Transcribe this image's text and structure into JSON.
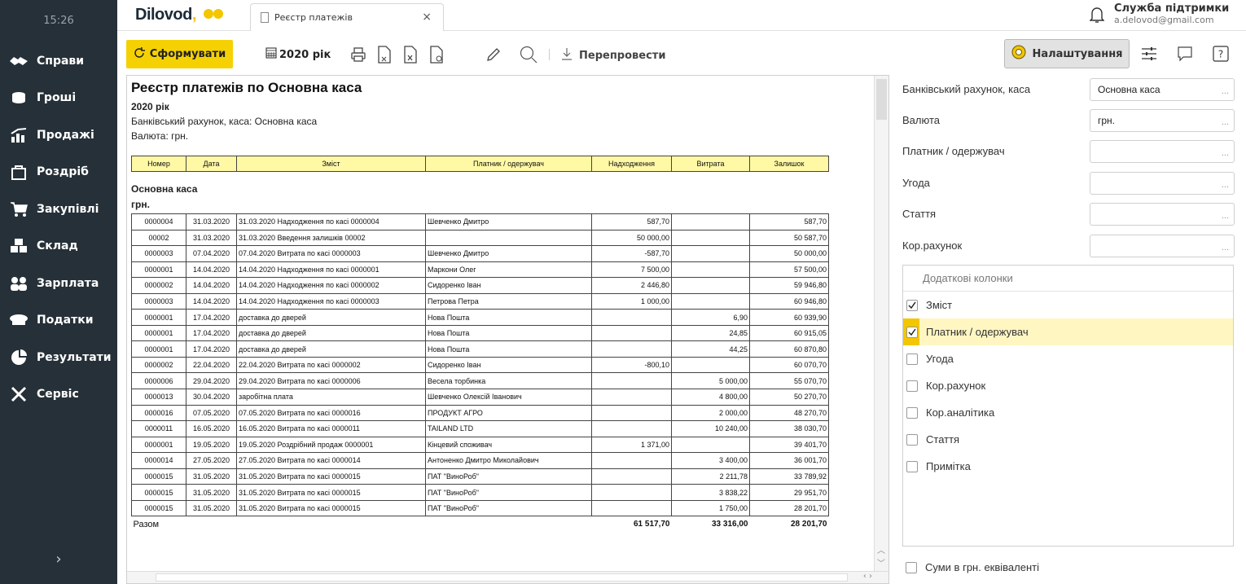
{
  "sidebar": {
    "time": "15:26",
    "items": [
      {
        "label": "Справи",
        "icon": "handshake-icon"
      },
      {
        "label": "Гроші",
        "icon": "coins-icon"
      },
      {
        "label": "Продажі",
        "icon": "chart-icon"
      },
      {
        "label": "Роздріб",
        "icon": "shopping-bag-icon"
      },
      {
        "label": "Закупівлі",
        "icon": "cart-icon"
      },
      {
        "label": "Склад",
        "icon": "boxes-icon"
      },
      {
        "label": "Зарплата",
        "icon": "people-icon"
      },
      {
        "label": "Податки",
        "icon": "hat-icon"
      },
      {
        "label": "Результати",
        "icon": "pie-chart-icon"
      },
      {
        "label": "Сервіс",
        "icon": "tools-icon"
      }
    ],
    "expand": "›"
  },
  "topbar": {
    "logo": "Dilovod",
    "logo_comma": ",",
    "tab_title": "Реєстр платежів",
    "tab_close": "×",
    "support_title": "Служба підтримки",
    "support_email": "a.delovod@gmail.com"
  },
  "toolbar": {
    "form_label": "Сформувати",
    "year_label": "2020 рік",
    "repost_label": "Перепровести",
    "settings_label": "Налаштування"
  },
  "report": {
    "title": "Реєстр платежів по Основна каса",
    "period": "2020 рік",
    "account_line": "Банківський рахунок, каса: Основна каса",
    "currency_line": "Валюта: грн.",
    "headers": [
      "Номер",
      "Дата",
      "Зміст",
      "Платник / одержувач",
      "Надходження",
      "Витрата",
      "Залишок"
    ],
    "group": "Основна каса",
    "group_currency": "грн.",
    "rows": [
      [
        "0000004",
        "31.03.2020",
        "31.03.2020 Надходження по касі 0000004",
        "Шевченко Дмитро",
        "587,70",
        "",
        "587,70"
      ],
      [
        "00002",
        "31.03.2020",
        "31.03.2020 Введення залишків 00002",
        "",
        "50 000,00",
        "",
        "50 587,70"
      ],
      [
        "0000003",
        "07.04.2020",
        "07.04.2020 Витрата по касі 0000003",
        "Шевченко Дмитро",
        "-587,70",
        "",
        "50 000,00"
      ],
      [
        "0000001",
        "14.04.2020",
        "14.04.2020 Надходження по касі 0000001",
        "Маркони Олег",
        "7 500,00",
        "",
        "57 500,00"
      ],
      [
        "0000002",
        "14.04.2020",
        "14.04.2020 Надходження по касі 0000002",
        "Сидоренко Іван",
        "2 446,80",
        "",
        "59 946,80"
      ],
      [
        "0000003",
        "14.04.2020",
        "14.04.2020 Надходження по касі 0000003",
        "Петрова Петра",
        "1 000,00",
        "",
        "60 946,80"
      ],
      [
        "0000001",
        "17.04.2020",
        "доставка до дверей",
        "Нова Пошта",
        "",
        "6,90",
        "60 939,90"
      ],
      [
        "0000001",
        "17.04.2020",
        "доставка до дверей",
        "Нова Пошта",
        "",
        "24,85",
        "60 915,05"
      ],
      [
        "0000001",
        "17.04.2020",
        "доставка до дверей",
        "Нова Пошта",
        "",
        "44,25",
        "60 870,80"
      ],
      [
        "0000002",
        "22.04.2020",
        "22.04.2020 Витрата по касі 0000002",
        "Сидоренко Іван",
        "-800,10",
        "",
        "60 070,70"
      ],
      [
        "0000006",
        "29.04.2020",
        "29.04.2020 Витрата по касі 0000006",
        "Весела торбинка",
        "",
        "5 000,00",
        "55 070,70"
      ],
      [
        "0000013",
        "30.04.2020",
        "заробітна плата",
        "Шевченко Олексій Іванович",
        "",
        "4 800,00",
        "50 270,70"
      ],
      [
        "0000016",
        "07.05.2020",
        "07.05.2020 Витрата по касі 0000016",
        "ПРОДУКТ АГРО",
        "",
        "2 000,00",
        "48 270,70"
      ],
      [
        "0000011",
        "16.05.2020",
        "16.05.2020 Витрата по касі 0000011",
        "TAILAND LTD",
        "",
        "10 240,00",
        "38 030,70"
      ],
      [
        "0000001",
        "19.05.2020",
        "19.05.2020 Роздрібний продаж 0000001",
        "Кінцевий споживач",
        "1 371,00",
        "",
        "39 401,70"
      ],
      [
        "0000014",
        "27.05.2020",
        "27.05.2020 Витрата по касі 0000014",
        "Антоненко Дмитро Миколайович",
        "",
        "3 400,00",
        "36 001,70"
      ],
      [
        "0000015",
        "31.05.2020",
        "31.05.2020 Витрата по касі 0000015",
        "ПАТ \"ВиноРоб\"",
        "",
        "2 211,78",
        "33 789,92"
      ],
      [
        "0000015",
        "31.05.2020",
        "31.05.2020 Витрата по касі 0000015",
        "ПАТ \"ВиноРоб\"",
        "",
        "3 838,22",
        "29 951,70"
      ],
      [
        "0000015",
        "31.05.2020",
        "31.05.2020 Витрата по касі 0000015",
        "ПАТ \"ВиноРоб\"",
        "",
        "1 750,00",
        "28 201,70"
      ]
    ],
    "total_label": "Разом",
    "total_income": "61 517,70",
    "total_expense": "33 316,00",
    "total_balance": "28 201,70"
  },
  "panel": {
    "fields": [
      {
        "label": "Банківський рахунок, каса",
        "value": "Основна каса"
      },
      {
        "label": "Валюта",
        "value": "грн."
      },
      {
        "label": "Платник / одержувач",
        "value": ""
      },
      {
        "label": "Угода",
        "value": ""
      },
      {
        "label": "Стаття",
        "value": ""
      },
      {
        "label": "Кор.рахунок",
        "value": ""
      }
    ],
    "dots": "...",
    "columns_title": "Додаткові колонки",
    "columns": [
      {
        "label": "Зміст",
        "checked": true
      },
      {
        "label": "Платник / одержувач",
        "checked": true
      },
      {
        "label": "Угода",
        "checked": false
      },
      {
        "label": "Кор.рахунок",
        "checked": false
      },
      {
        "label": "Кор.аналітика",
        "checked": false
      },
      {
        "label": "Стаття",
        "checked": false
      },
      {
        "label": "Примітка",
        "checked": false
      }
    ],
    "equivalent_label": "Суми в грн. еквіваленті"
  },
  "colors": {
    "accent": "#f5d104",
    "sidebar": "#263038",
    "highlight": "#fff6c2"
  }
}
